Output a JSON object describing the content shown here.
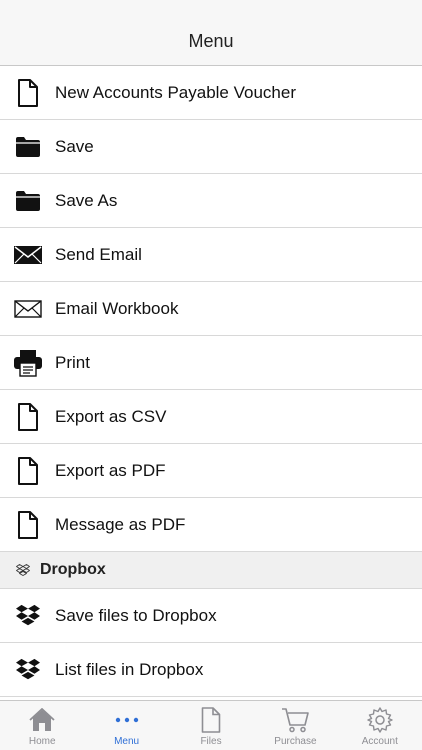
{
  "header": {
    "title": "Menu"
  },
  "menu": {
    "items": [
      {
        "label": "New Accounts Payable Voucher",
        "icon": "document-icon"
      },
      {
        "label": "Save",
        "icon": "folder-icon"
      },
      {
        "label": "Save As",
        "icon": "folder-icon"
      },
      {
        "label": "Send Email",
        "icon": "envelope-filled-icon"
      },
      {
        "label": "Email Workbook",
        "icon": "envelope-outline-icon"
      },
      {
        "label": "Print",
        "icon": "printer-icon"
      },
      {
        "label": "Export as CSV",
        "icon": "document-icon"
      },
      {
        "label": "Export as PDF",
        "icon": "document-icon"
      },
      {
        "label": "Message as PDF",
        "icon": "document-icon"
      }
    ]
  },
  "dropbox": {
    "title": "Dropbox",
    "items": [
      {
        "label": "Save files to Dropbox",
        "icon": "dropbox-icon"
      },
      {
        "label": "List files in Dropbox",
        "icon": "dropbox-icon"
      }
    ]
  },
  "tabbar": {
    "accent": "#2f6fd6",
    "tabs": [
      {
        "label": "Home",
        "icon": "home-icon",
        "active": false
      },
      {
        "label": "Menu",
        "icon": "more-dots-icon",
        "active": true
      },
      {
        "label": "Files",
        "icon": "file-icon",
        "active": false
      },
      {
        "label": "Purchase",
        "icon": "cart-icon",
        "active": false
      },
      {
        "label": "Account",
        "icon": "gear-icon",
        "active": false
      }
    ]
  }
}
